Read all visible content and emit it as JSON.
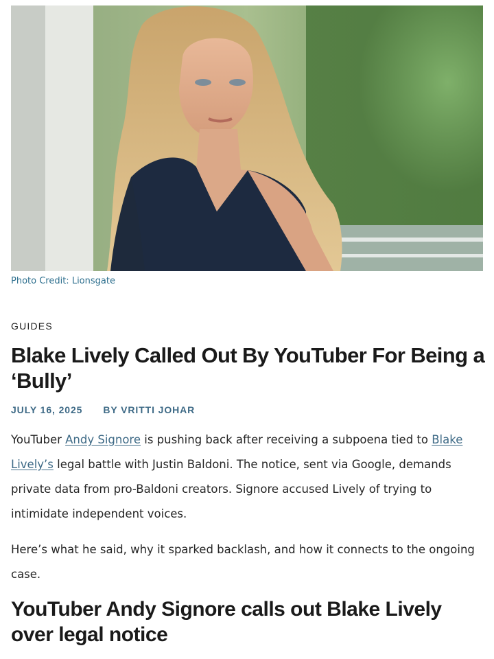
{
  "hero": {
    "credit": "Photo Credit: Lionsgate"
  },
  "article": {
    "category": "GUIDES",
    "title": "Blake Lively Called Out By YouTuber For Being a ‘Bully’",
    "date": "JULY 16, 2025",
    "author": "BY VRITTI JOHAR",
    "p1": {
      "t1": "YouTuber ",
      "link1": "Andy Signore",
      "t2": " is pushing back after receiving a subpoena tied to ",
      "link2": "Blake Lively’s",
      "t3": " legal battle with Justin Baldoni. The notice, sent via Google, demands private data from pro-Baldoni creators. Signore accused Lively of trying to intimidate independent voices."
    },
    "p2": "Here’s what he said, why it sparked backlash, and how it connects to the ongoing case.",
    "subheading": "YouTuber Andy Signore calls out Blake Lively over legal notice"
  },
  "colors": {
    "link": "#3e6a86",
    "credit": "#2d6f8e",
    "text": "#262626"
  }
}
